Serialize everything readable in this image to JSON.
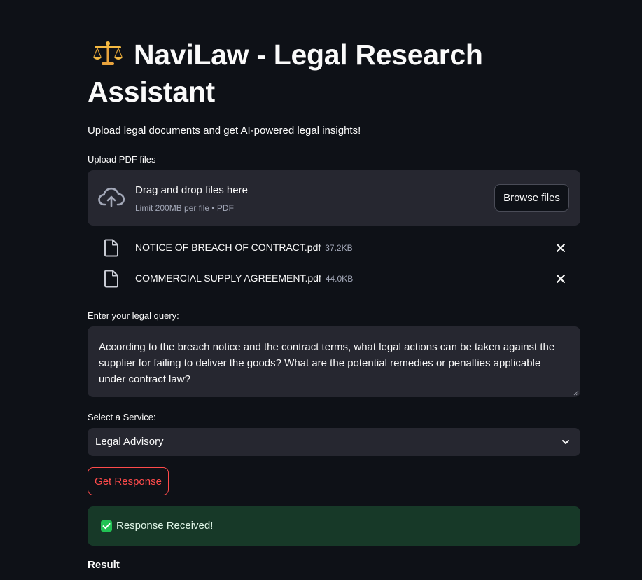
{
  "header": {
    "title_emoji": "scales-icon",
    "title": "NaviLaw - Legal Research Assistant",
    "subtitle": "Upload legal documents and get AI-powered legal insights!"
  },
  "uploader": {
    "label": "Upload PDF files",
    "drop_title": "Drag and drop files here",
    "limit_text": "Limit 200MB per file • PDF",
    "browse_label": "Browse files",
    "files": [
      {
        "name": "NOTICE OF BREACH OF CONTRACT.pdf",
        "size": "37.2KB"
      },
      {
        "name": "COMMERCIAL SUPPLY AGREEMENT.pdf",
        "size": "44.0KB"
      }
    ]
  },
  "query": {
    "label": "Enter your legal query:",
    "value": "According to the breach notice and the contract terms, what legal actions can be taken against the supplier for failing to deliver the goods? What are the potential remedies or penalties applicable under contract law?"
  },
  "service": {
    "label": "Select a Service:",
    "selected": "Legal Advisory"
  },
  "actions": {
    "get_response_label": "Get Response"
  },
  "status": {
    "success_text": "Response Received!"
  },
  "result": {
    "heading": "Result"
  },
  "colors": {
    "background": "#0e1117",
    "widget": "#262730",
    "accent_red": "#ff4b4b",
    "success_bg": "#173928",
    "success_check": "#21c354"
  }
}
